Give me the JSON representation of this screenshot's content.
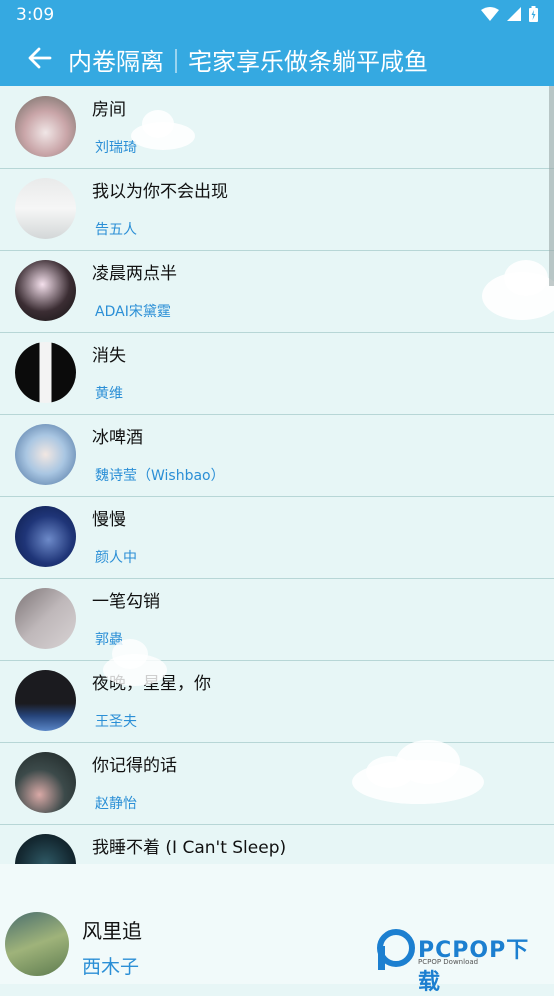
{
  "status_bar": {
    "time": "3:09"
  },
  "header": {
    "title": "内卷隔离｜宅家享乐做条躺平咸鱼"
  },
  "songs": [
    {
      "title": "房间",
      "artist": "刘瑞琦"
    },
    {
      "title": "我以为你不会出现",
      "artist": "告五人"
    },
    {
      "title": "凌晨两点半",
      "artist": "ADAI宋黛霆"
    },
    {
      "title": "消失",
      "artist": "黄维"
    },
    {
      "title": "冰啤酒",
      "artist": "魏诗莹（Wishbao）"
    },
    {
      "title": "慢慢",
      "artist": "颜人中"
    },
    {
      "title": "一笔勾销",
      "artist": "郭蟲"
    },
    {
      "title": "夜晚，星星，你",
      "artist": "王圣夫"
    },
    {
      "title": "你记得的话",
      "artist": "赵静怡"
    },
    {
      "title": "我睡不着 (I Can't Sleep)",
      "artist": ""
    }
  ],
  "now_playing": {
    "title": "风里追",
    "artist": "西木子"
  },
  "watermark": {
    "brand": "PCPOP下载",
    "subtitle": "PCPOP Download"
  },
  "colors": {
    "accent": "#35a9e1",
    "link": "#2b8fd6",
    "background": "#e7f6f6"
  }
}
